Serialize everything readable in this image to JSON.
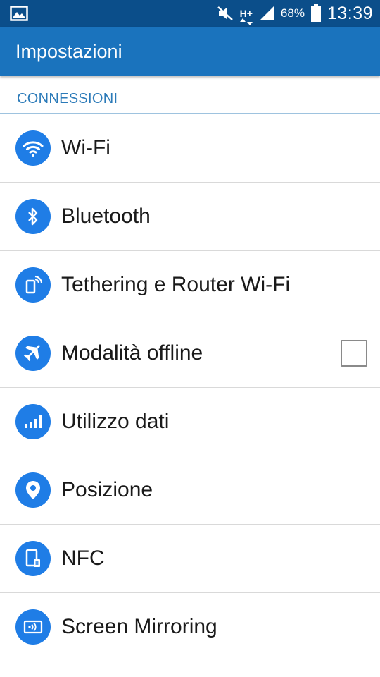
{
  "status_bar": {
    "battery": "68%",
    "time": "13:39",
    "network": "H+"
  },
  "action_bar": {
    "title": "Impostazioni"
  },
  "section": {
    "title": "CONNESSIONI"
  },
  "items": [
    {
      "label": "Wi-Fi",
      "icon": "wifi-icon"
    },
    {
      "label": "Bluetooth",
      "icon": "bluetooth-icon"
    },
    {
      "label": "Tethering e Router Wi-Fi",
      "icon": "tethering-icon"
    },
    {
      "label": "Modalità offline",
      "icon": "airplane-icon",
      "checked": false
    },
    {
      "label": "Utilizzo dati",
      "icon": "data-usage-icon"
    },
    {
      "label": "Posizione",
      "icon": "location-icon"
    },
    {
      "label": "NFC",
      "icon": "nfc-icon"
    },
    {
      "label": "Screen Mirroring",
      "icon": "screen-mirroring-icon"
    }
  ],
  "colors": {
    "status_bar": "#0b4e8a",
    "action_bar": "#1a73bd",
    "section_title": "#2b7ab8",
    "icon_bg": "#1f7de6"
  }
}
